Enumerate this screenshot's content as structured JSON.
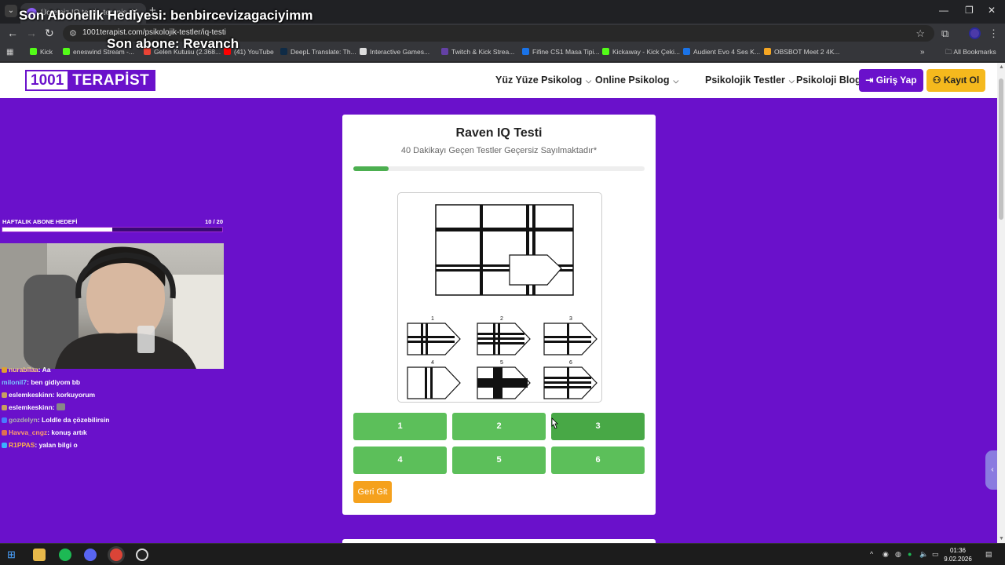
{
  "browser": {
    "tab_title": "Ücretsiz IQ testi - terapist.com",
    "url": "1001terapist.com/psikolojik-testler/iq-testi",
    "bookmarks": [
      {
        "label": "Kick",
        "color": "#53fc18"
      },
      {
        "label": "eneswind Stream -...",
        "color": "#53fc18"
      },
      {
        "label": "Gelen Kutusu (2.368...",
        "color": "#ea4335"
      },
      {
        "label": "(41) YouTube",
        "color": "#ff0000"
      },
      {
        "label": "DeepL Translate: Th...",
        "color": "#0f2b46"
      },
      {
        "label": "Interactive Games...",
        "color": "#dddddd"
      },
      {
        "label": "Twitch & Kick Strea...",
        "color": "#6441a5"
      },
      {
        "label": "Fifine CS1 Masa Tipi...",
        "color": "#1a73e8"
      },
      {
        "label": "Kickaway - Kick Çeki...",
        "color": "#53fc18"
      },
      {
        "label": "Audient Evo 4 Ses K...",
        "color": "#1a73e8"
      },
      {
        "label": "OBSBOT Meet 2 4K...",
        "color": "#f5a623"
      }
    ],
    "all_bookmarks": "All Bookmarks"
  },
  "overlay": {
    "gift_text": "Son Abonelik Hediyesi: benbircevizagaciyimm",
    "sub_text": "Son abone: Revanch"
  },
  "site": {
    "logo_num": "1001",
    "logo_text": "TERAPİST",
    "nav": [
      "Yüz Yüze Psikolog",
      "Online Psikolog",
      "Psikolojik Testler",
      "Psikoloji Blog"
    ],
    "login": "Giriş Yap",
    "register": "Kayıt Ol"
  },
  "test": {
    "title": "Raven IQ Testi",
    "subtitle": "40 Dakikayı Geçen Testler Geçersiz Sayılmaktadır*",
    "progress_fraction": 0.12,
    "option_numbers": [
      "1",
      "2",
      "3",
      "4",
      "5",
      "6"
    ],
    "answers": [
      "1",
      "2",
      "3",
      "4",
      "5",
      "6"
    ],
    "back": "Geri Git"
  },
  "stream": {
    "goal_label": "HAFTALIK ABONE HEDEFİ",
    "goal_count": "10  / 20",
    "goal_fraction": 0.5,
    "chat": [
      {
        "user": "nurabilaa",
        "msg": ": Aa",
        "color": "#ffd27a",
        "badge": "#e0a030"
      },
      {
        "user": "milonil7",
        "msg": ": ben gidiyom bb",
        "color": "#7ac7ff",
        "badge": ""
      },
      {
        "user": "eslemkeskinn",
        "msg": ": korkuyorum",
        "color": "#ffffff",
        "badge": "#c9a060"
      },
      {
        "user": "eslemkeskinn",
        "msg": ": ",
        "color": "#ffffff",
        "badge": "#c9a060"
      },
      {
        "user": "gozdelyn",
        "msg": ": Loldle da çözebilirsin",
        "color": "#b0b0b0",
        "badge": "#4a7aff"
      },
      {
        "user": "Havva_cngz",
        "msg": ": konuş artık",
        "color": "#ff9f6a",
        "badge": "#e07050"
      },
      {
        "user": "R1PPAS",
        "msg": ": yalan bilgi o",
        "color": "#ffb44a",
        "badge": "#3ab0ff"
      }
    ]
  },
  "taskbar": {
    "time": "01:36",
    "date": "9.02.2026"
  }
}
